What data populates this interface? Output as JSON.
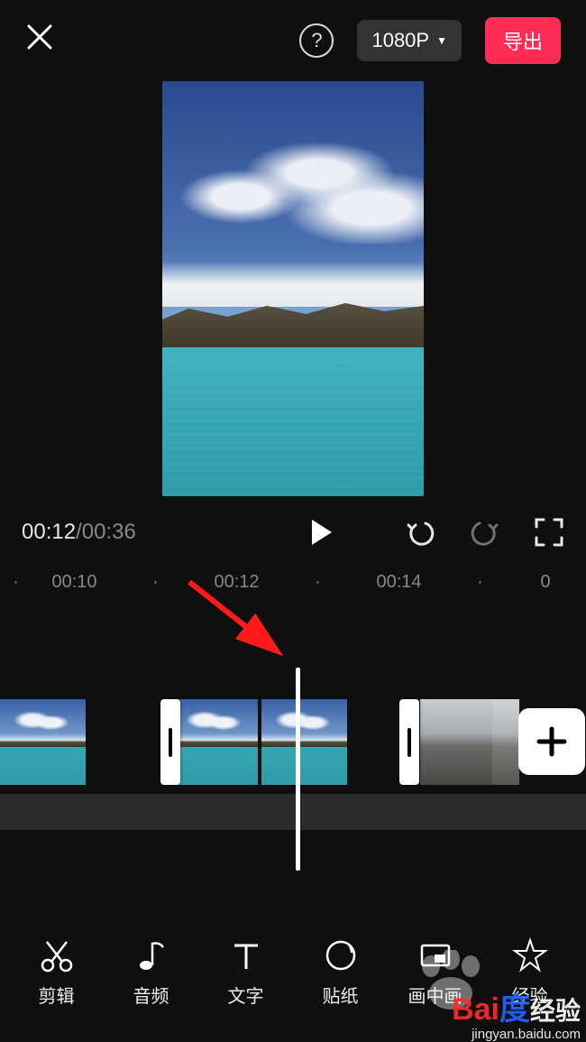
{
  "header": {
    "resolution": "1080P",
    "export_label": "导出"
  },
  "playback": {
    "current_time": "00:12",
    "total_time": "00:36"
  },
  "ruler": {
    "marks": [
      "00:10",
      "00:12",
      "00:14",
      "0"
    ]
  },
  "bottom_tools": {
    "edit": "剪辑",
    "audio": "音频",
    "text": "文字",
    "sticker": "贴纸",
    "pip": "画中画",
    "effect": "经验"
  },
  "watermark": {
    "brand_left": "Bai",
    "brand_right": "经验",
    "url": "jingyan.baidu.com"
  },
  "colors": {
    "accent": "#ff2d55"
  }
}
